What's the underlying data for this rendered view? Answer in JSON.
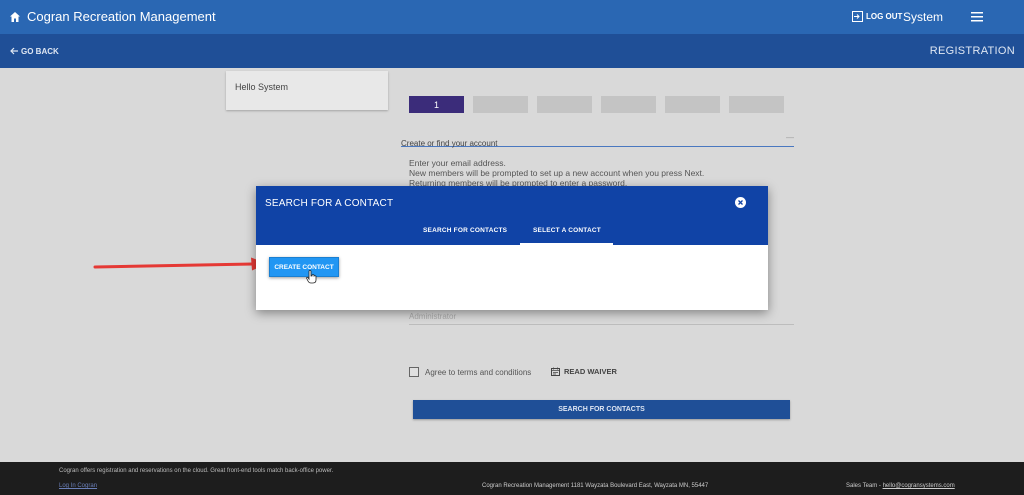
{
  "header": {
    "app_title": "Cogran Recreation Management",
    "logout_label": "LOG OUT",
    "user_name": "System",
    "home_icon": "home-icon",
    "menu_icon": "hamburger-menu-icon"
  },
  "subheader": {
    "go_back_label": "GO BACK",
    "section_title": "REGISTRATION"
  },
  "greeting": "Hello System",
  "steps": [
    "1",
    "",
    "",
    "",
    "",
    ""
  ],
  "account": {
    "heading": "Create or find your account",
    "dash": "—",
    "instructions": [
      "Enter your email address.",
      "New members will be prompted to set up a new account when you press Next.",
      "Returning members will be prompted to enter a password."
    ],
    "administrator_placeholder": "Administrator"
  },
  "terms": {
    "label": "Agree to terms and conditions",
    "waiver_label": "READ WAIVER"
  },
  "search_contacts_button": "SEARCH FOR CONTACTS",
  "dialog": {
    "title": "SEARCH FOR A CONTACT",
    "tabs": [
      "SEARCH FOR CONTACTS",
      "SELECT A CONTACT"
    ],
    "active_tab": "SELECT A CONTACT",
    "create_button": "CREATE CONTACT"
  },
  "footer": {
    "tagline": "Cogran offers registration and reservations on the cloud. Great front-end tools match back-office power.",
    "login_link": "Log In Cogran",
    "address": "Cogran Recreation Management 1181 Wayzata Boulevard East, Wayzata MN, 55447",
    "sales_prefix": "Sales Team - ",
    "sales_email": "hello@cogransystems.com"
  },
  "colors": {
    "topbar": "#2a67b3",
    "subbar": "#1f4f97",
    "dialog_header": "#1043a6",
    "create_button": "#2196f3",
    "active_step": "#3b2c7a",
    "annotation_arrow": "#e53935"
  }
}
